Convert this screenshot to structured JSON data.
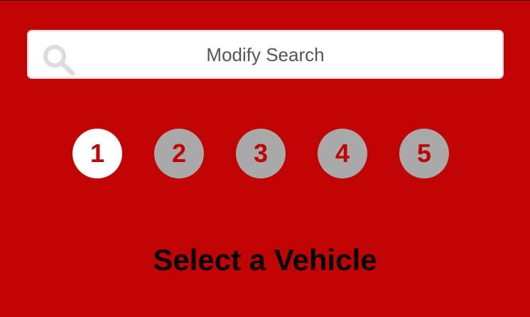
{
  "search": {
    "label": "Modify Search",
    "icon": "search-icon"
  },
  "steps": {
    "items": [
      {
        "label": "1",
        "active": true
      },
      {
        "label": "2",
        "active": false
      },
      {
        "label": "3",
        "active": false
      },
      {
        "label": "4",
        "active": false
      },
      {
        "label": "5",
        "active": false
      }
    ]
  },
  "main": {
    "title": "Select a Vehicle"
  },
  "colors": {
    "background": "#c10303",
    "step_inactive": "#a9a9a9",
    "step_active": "#ffffff",
    "step_number": "#c10303"
  }
}
